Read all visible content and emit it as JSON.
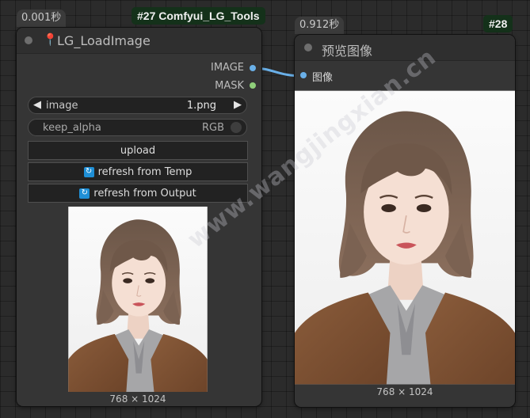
{
  "node27": {
    "time": "0.001秒",
    "id_badge": "#27 Comfyui_LG_Tools",
    "title": "LG_LoadImage",
    "outputs": [
      "IMAGE",
      "MASK"
    ],
    "image_widget": {
      "label": "image",
      "value": "1.png"
    },
    "keep_alpha": {
      "label": "keep_alpha",
      "value": "RGB"
    },
    "upload_label": "upload",
    "refresh_temp_label": "refresh from Temp",
    "refresh_output_label": "refresh from Output",
    "image_size": "768 × 1024"
  },
  "node28": {
    "time": "0.912秒",
    "id_badge": "#28",
    "title": "预览图像",
    "input_label": "图像",
    "image_size": "768 × 1024"
  },
  "watermark": "www.wangjingxian.cn",
  "colors": {
    "image_port": "#6ab0e8",
    "mask_port": "#8fcf7a",
    "link": "#6ab0e8",
    "refresh_icon": "#1f8fd6"
  },
  "icons": [
    "pin-icon",
    "refresh-icon",
    "arrow-left-icon",
    "arrow-right-icon",
    "toggle-icon"
  ]
}
